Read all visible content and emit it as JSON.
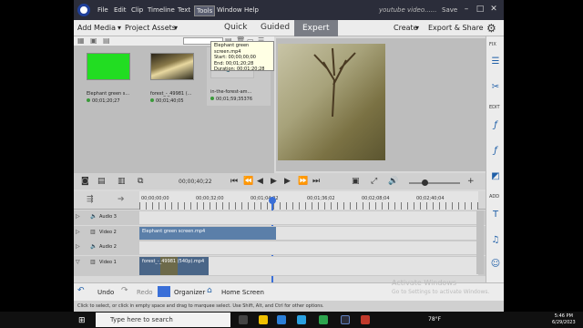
{
  "menubar": {
    "items": [
      "File",
      "Edit",
      "Clip",
      "Timeline",
      "Text",
      "Tools",
      "Window",
      "Help"
    ],
    "selected": "Tools",
    "window_title": "youtube video......",
    "save": "Save"
  },
  "modebar": {
    "add_media": "Add Media",
    "project_assets": "Project Assets",
    "modes": [
      "Quick",
      "Guided",
      "Expert"
    ],
    "active_mode": "Expert",
    "create": "Create",
    "export_share": "Export & Share"
  },
  "assets": [
    {
      "label": "Elephant green s...",
      "duration": "00;01;20;27",
      "kind": "green"
    },
    {
      "label": "forest_-_49981 (...",
      "duration": "00;01;40;05",
      "kind": "forest"
    },
    {
      "label": "in-the-forest-am...",
      "duration": "00;01;59;35376",
      "kind": "audio"
    }
  ],
  "transport": {
    "timecode": "00;00;40;22"
  },
  "ruler": {
    "ticks": [
      "00;00;00;00",
      "00;00;32;00",
      "00;01;04;02",
      "00;01;36;02",
      "00;02;08;04",
      "00;02;40;04"
    ]
  },
  "tracks": [
    {
      "name": "Audio 3",
      "type": "audio"
    },
    {
      "name": "Video 2",
      "type": "video",
      "clip": "Elephant green screen.mp4"
    },
    {
      "name": "Audio 2",
      "type": "audio"
    },
    {
      "name": "Video 1",
      "type": "video",
      "clip": "forest_-_49981 (540p).mp4"
    }
  ],
  "tooltip": {
    "title": "Elephant green screen.mp4",
    "start": "Start: 00;00;00;00",
    "end": "End: 00;01;20;28",
    "duration": "Duration: 00;01;20;28"
  },
  "bottombar": {
    "undo": "Undo",
    "redo": "Redo",
    "organizer": "Organizer",
    "home": "Home Screen"
  },
  "statusbar": {
    "text": "Click to select, or click in empty space and drag to marquee select. Use Shift, Alt, and Ctrl for other options."
  },
  "sidebar": {
    "fix": "FIX",
    "edit": "EDIT",
    "add": "ADD"
  },
  "watermark": {
    "title": "Activate Windows",
    "sub": "Go to Settings to activate Windows."
  },
  "taskbar": {
    "search_placeholder": "Type here to search",
    "weather": "78°F",
    "time": "5:46 PM",
    "date": "6/29/2023"
  },
  "colors": {
    "menubar": "#2b2d3a",
    "accent": "#3a6fd8",
    "clip_video2": "#5b7fa9",
    "clip_video1": "#4a6688",
    "green": "#22dd22"
  }
}
